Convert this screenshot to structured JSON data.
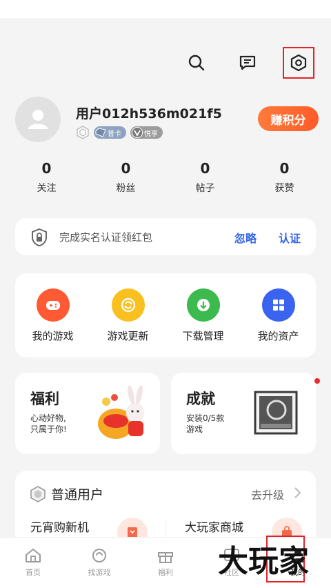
{
  "header": {
    "icons": [
      "search-icon",
      "message-icon",
      "settings-icon"
    ]
  },
  "profile": {
    "username": "用户012h536m021f5",
    "badges": [
      {
        "icon": "hexagon-level-icon"
      },
      {
        "label": "普卡",
        "icon": "card-tier-icon"
      },
      {
        "label": "悦享",
        "icon": "vip-icon"
      }
    ],
    "earn_button": "赚积分"
  },
  "stats": [
    {
      "value": "0",
      "label": "关注"
    },
    {
      "value": "0",
      "label": "粉丝"
    },
    {
      "value": "0",
      "label": "帖子"
    },
    {
      "value": "0",
      "label": "获赞"
    }
  ],
  "verify": {
    "text": "完成实名认证领红包",
    "ignore": "忽略",
    "confirm": "认证"
  },
  "shortcuts": [
    {
      "label": "我的游戏",
      "icon": "gamepad-icon",
      "color": "#ff5a33"
    },
    {
      "label": "游戏更新",
      "icon": "refresh-icon",
      "color": "#f9c01f"
    },
    {
      "label": "下载管理",
      "icon": "download-icon",
      "color": "#3dba4e"
    },
    {
      "label": "我的资产",
      "icon": "grid-icon",
      "color": "#3a63ef"
    }
  ],
  "promos": {
    "welfare": {
      "title": "福利",
      "subtitle": "心动好物,\n只属于你!"
    },
    "achievement": {
      "title": "成就",
      "subtitle": "安装0/5款\n游戏"
    }
  },
  "tier": {
    "title": "普通用户",
    "upgrade": "去升级",
    "items": [
      "元宵购新机",
      "大玩家商城"
    ]
  },
  "tabs": [
    {
      "label": "首页",
      "icon": "home-icon"
    },
    {
      "label": "找游戏",
      "icon": "find-game-icon"
    },
    {
      "label": "福利",
      "icon": "gift-icon"
    },
    {
      "label": "社区",
      "icon": "community-icon"
    },
    {
      "label": "我的",
      "icon": "profile-icon",
      "active": true
    }
  ],
  "watermark": "大玩家",
  "colors": {
    "accent": "#3566e8",
    "earn": "#ff6a30",
    "highlight": "#e1222a"
  }
}
